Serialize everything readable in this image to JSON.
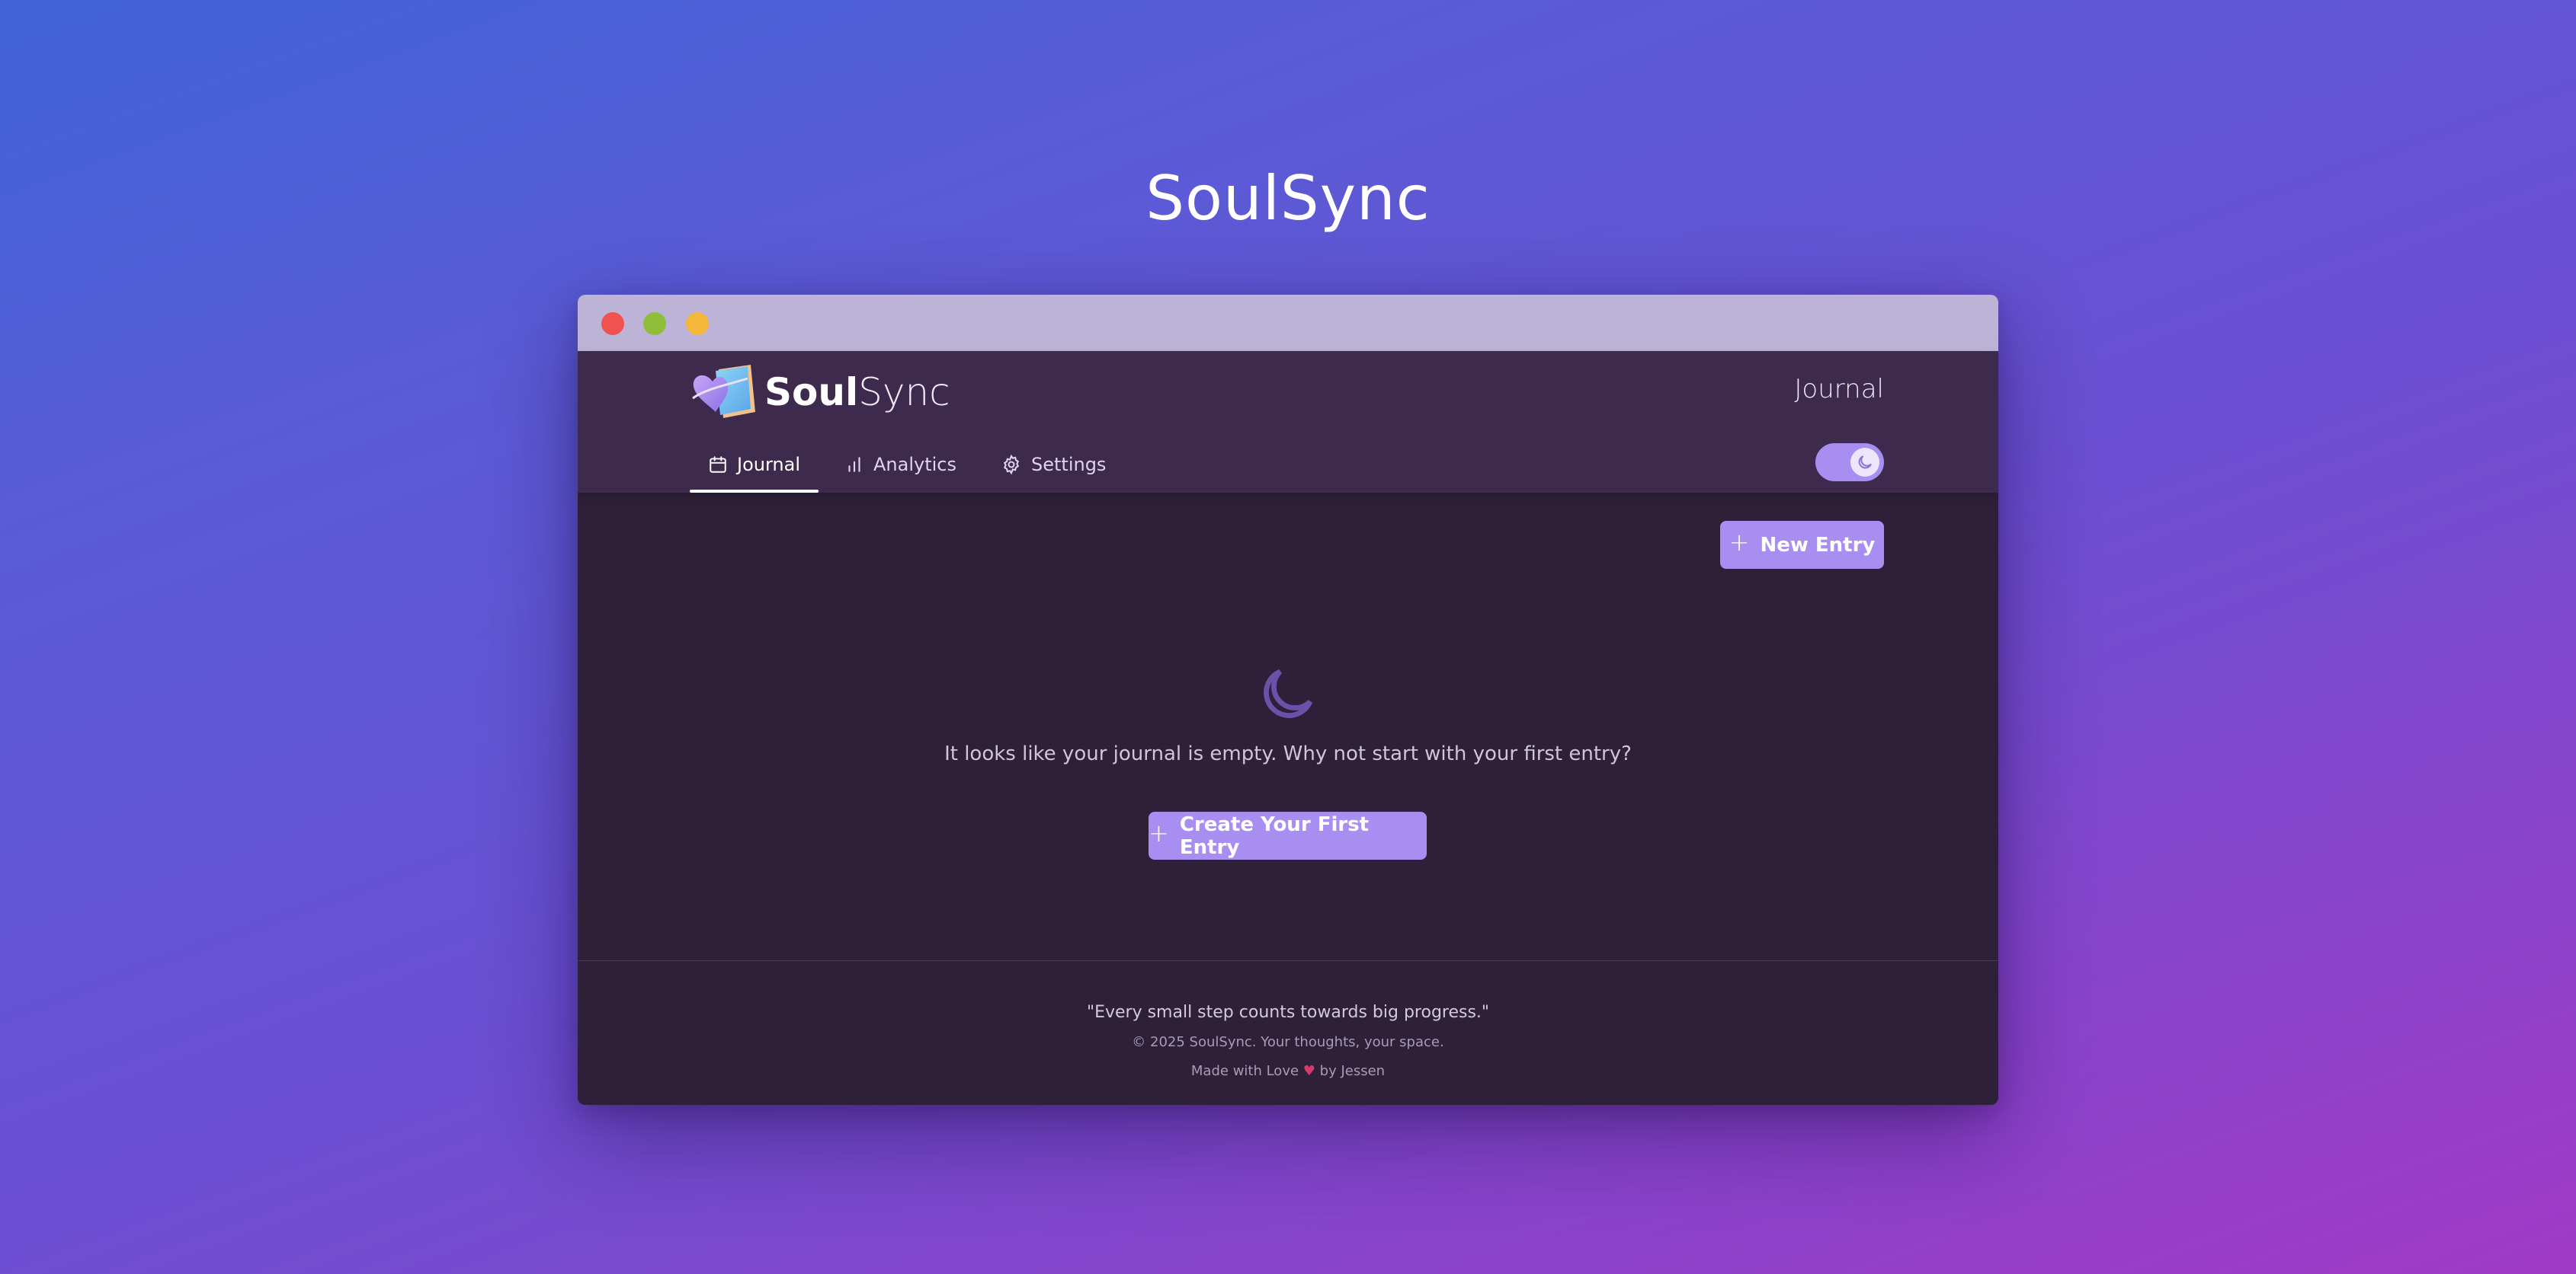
{
  "hero": {
    "title": "SoulSync"
  },
  "window": {
    "controls": [
      "close",
      "minimize",
      "maximize"
    ]
  },
  "header": {
    "brand_bold": "Soul",
    "brand_light": "Sync",
    "page_title": "Journal"
  },
  "nav": {
    "items": [
      {
        "label": "Journal",
        "icon": "calendar-icon",
        "active": true
      },
      {
        "label": "Analytics",
        "icon": "bar-chart-icon",
        "active": false
      },
      {
        "label": "Settings",
        "icon": "gear-icon",
        "active": false
      }
    ]
  },
  "theme_toggle": {
    "state": "dark",
    "icon": "moon-icon"
  },
  "main": {
    "new_entry_label": "New Entry",
    "empty_icon": "moon-icon",
    "empty_message": "It looks like your journal is empty. Why not start with your first entry?",
    "create_first_label": "Create Your First Entry"
  },
  "footer": {
    "quote": "\"Every small step counts towards big progress.\"",
    "copyright": "© 2025 SoulSync. Your thoughts, your space.",
    "made_prefix": "Made with Love",
    "heart": "♥",
    "made_suffix": "by Jessen"
  },
  "colors": {
    "accent": "#a98ef2",
    "header_bg": "#3d2a4d",
    "content_bg": "#2e2039",
    "titlebar": "#bdb3d6",
    "close": "#f0524f",
    "minimize": "#8fbf38",
    "maximize": "#f5b73a"
  }
}
